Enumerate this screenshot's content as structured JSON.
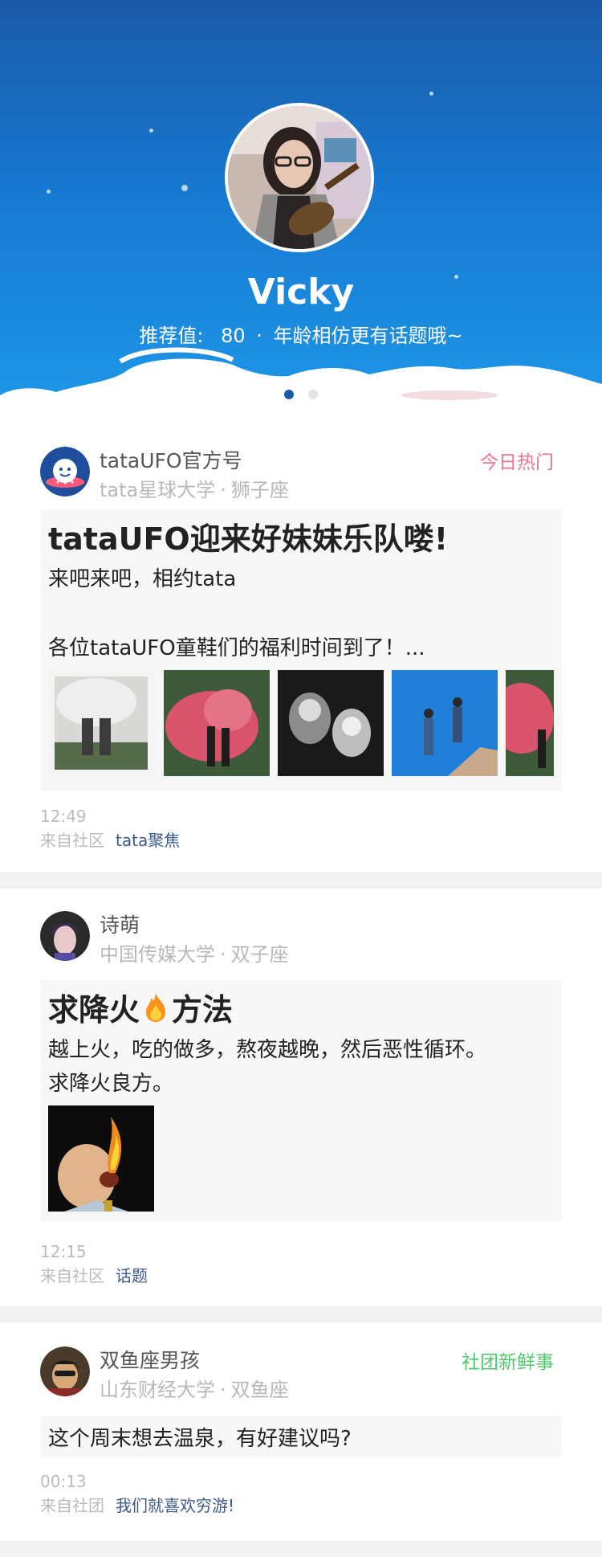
{
  "profile": {
    "name": "Vicky",
    "recommend_label": "推荐值:",
    "recommend_value": "80",
    "separator": "·",
    "age_note": "年龄相仿更有话题哦~"
  },
  "feed": [
    {
      "author": "tataUFO官方号",
      "school": "tata星球大学",
      "zodiac": "狮子座",
      "tag": "今日热门",
      "title": "tataUFO迎来好妹妹乐队喽!",
      "line1": "来吧来吧，相约tata",
      "line2": "各位tataUFO童鞋们的福利时间到了！...",
      "time": "12:49",
      "from_label": "来自社区",
      "source": "tata聚焦"
    },
    {
      "author": "诗萌",
      "school": "中国传媒大学",
      "zodiac": "双子座",
      "title_prefix": "求降火",
      "title_suffix": "方法",
      "line1": "越上火，吃的做多，熬夜越晚，然后恶性循环。",
      "line2": "求降火良方。",
      "time": "12:15",
      "from_label": "来自社区",
      "source": "话题"
    },
    {
      "author": "双鱼座男孩",
      "school": "山东财经大学",
      "zodiac": "双鱼座",
      "tag": "社团新鲜事",
      "line1": "这个周末想去温泉，有好建议吗?",
      "time": "00:13",
      "from_label": "来自社团",
      "source": "我们就喜欢穷游!"
    }
  ],
  "colors": {
    "hot_tag": "#f0728e",
    "club_tag": "#4cc96a",
    "source_link": "#3b5b8a",
    "header_top": "#1a5aa8",
    "header_bottom": "#1e98e8"
  },
  "icons": {
    "fire": "fire-icon",
    "ufo_logo": "ufo-logo-icon"
  },
  "pager": {
    "pages": 2,
    "current": 1
  }
}
